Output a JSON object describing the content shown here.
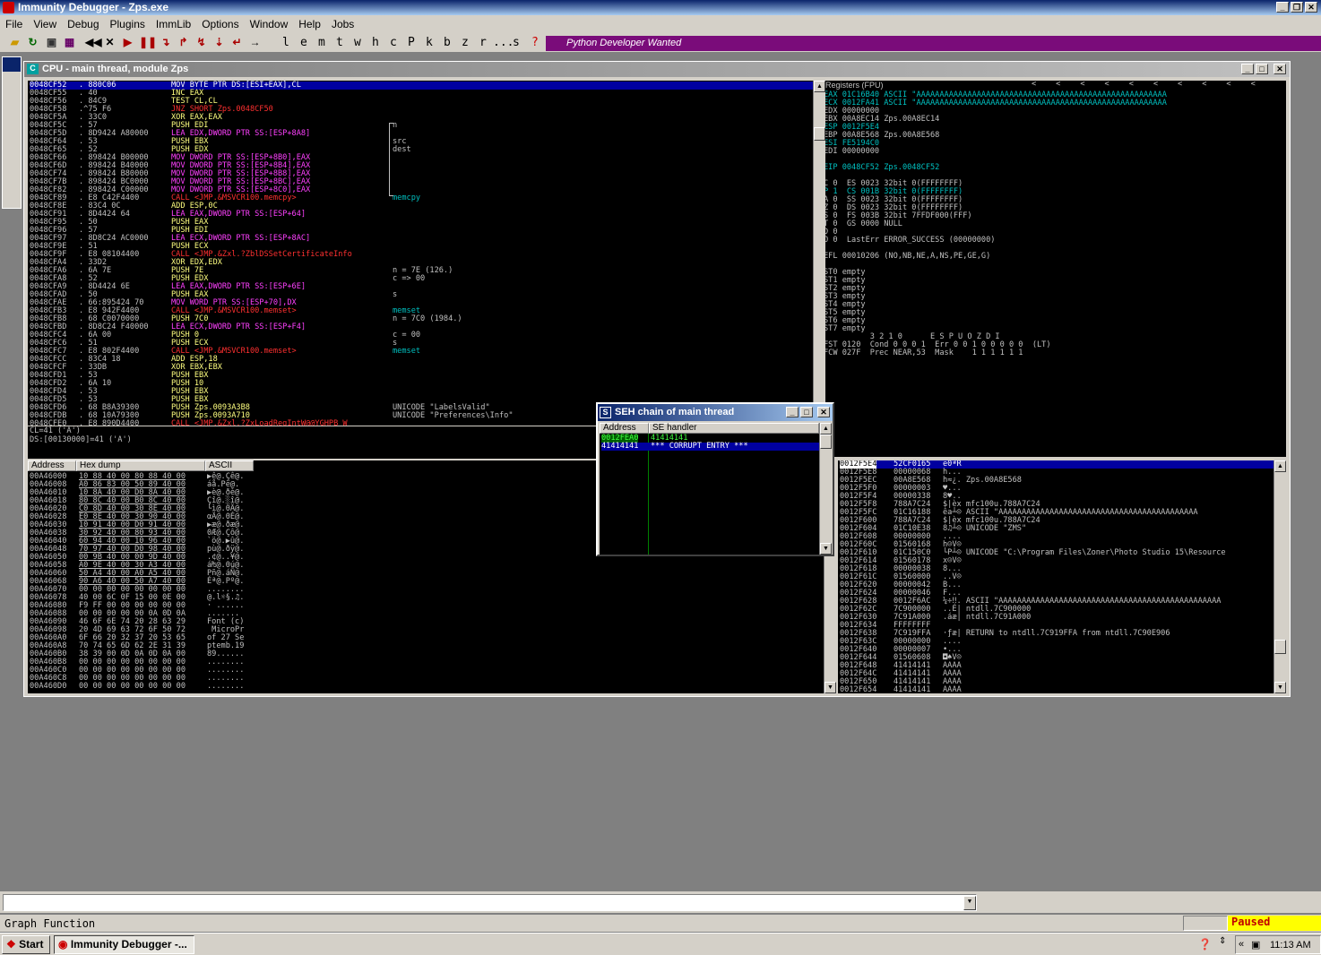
{
  "window": {
    "title": "Immunity Debugger - Zps.exe"
  },
  "menu": [
    "File",
    "View",
    "Debug",
    "Plugins",
    "ImmLib",
    "Options",
    "Window",
    "Help",
    "Jobs"
  ],
  "toolbar": {
    "letters": [
      "l",
      "e",
      "m",
      "t",
      "w",
      "h",
      "c",
      "P",
      "k",
      "b",
      "z",
      "r",
      "...",
      "s",
      "?"
    ],
    "banner": "Python Developer Wanted"
  },
  "cpu": {
    "title": "CPU - main thread, module Zps"
  },
  "disasm": [
    [
      "0048CF52",
      ". 880C06",
      "MOV BYTE PTR DS:[ESI+EAX],CL",
      ""
    ],
    [
      "0048CF55",
      ". 40",
      "INC EAX",
      ""
    ],
    [
      "0048CF56",
      ". 84C9",
      "TEST CL,CL",
      ""
    ],
    [
      "0048CF58",
      ".^75 F6",
      "JNZ SHORT Zps.0048CF50",
      ""
    ],
    [
      "0048CF5A",
      ". 33C0",
      "XOR EAX,EAX",
      ""
    ],
    [
      "0048CF5C",
      ". 57",
      "PUSH EDI",
      "n"
    ],
    [
      "0048CF5D",
      ". 8D9424 A80000",
      "LEA EDX,DWORD PTR SS:[ESP+8A8]",
      ""
    ],
    [
      "0048CF64",
      ". 53",
      "PUSH EBX",
      "src"
    ],
    [
      "0048CF65",
      ". 52",
      "PUSH EDX",
      "dest"
    ],
    [
      "0048CF66",
      ". 898424 B00000",
      "MOV DWORD PTR SS:[ESP+8B0],EAX",
      ""
    ],
    [
      "0048CF6D",
      ". 898424 B40000",
      "MOV DWORD PTR SS:[ESP+8B4],EAX",
      ""
    ],
    [
      "0048CF74",
      ". 898424 B80000",
      "MOV DWORD PTR SS:[ESP+8B8],EAX",
      ""
    ],
    [
      "0048CF7B",
      ". 898424 BC0000",
      "MOV DWORD PTR SS:[ESP+8BC],EAX",
      ""
    ],
    [
      "0048CF82",
      ". 898424 C00000",
      "MOV DWORD PTR SS:[ESP+8C0],EAX",
      ""
    ],
    [
      "0048CF89",
      ". E8 C42F4400",
      "CALL <JMP.&MSVCR100.memcpy>",
      "memcpy"
    ],
    [
      "0048CF8E",
      ". 83C4 0C",
      "ADD ESP,0C",
      ""
    ],
    [
      "0048CF91",
      ". 8D4424 64",
      "LEA EAX,DWORD PTR SS:[ESP+64]",
      ""
    ],
    [
      "0048CF95",
      ". 50",
      "PUSH EAX",
      ""
    ],
    [
      "0048CF96",
      ". 57",
      "PUSH EDI",
      ""
    ],
    [
      "0048CF97",
      ". 8D8C24 AC0000",
      "LEA ECX,DWORD PTR SS:[ESP+8AC]",
      ""
    ],
    [
      "0048CF9E",
      ". 51",
      "PUSH ECX",
      ""
    ],
    [
      "0048CF9F",
      ". E8 08104400",
      "CALL <JMP.&Zxl.?ZblDSSetCertificateInfo",
      ""
    ],
    [
      "0048CFA4",
      ". 33D2",
      "XOR EDX,EDX",
      ""
    ],
    [
      "0048CFA6",
      ". 6A 7E",
      "PUSH 7E",
      "n = 7E (126.)"
    ],
    [
      "0048CFA8",
      ". 52",
      "PUSH EDX",
      "c => 00"
    ],
    [
      "0048CFA9",
      ". 8D4424 6E",
      "LEA EAX,DWORD PTR SS:[ESP+6E]",
      ""
    ],
    [
      "0048CFAD",
      ". 50",
      "PUSH EAX",
      "s"
    ],
    [
      "0048CFAE",
      ". 66:895424 70",
      "MOV WORD PTR SS:[ESP+70],DX",
      ""
    ],
    [
      "0048CFB3",
      ". E8 942F4400",
      "CALL <JMP.&MSVCR100.memset>",
      "memset"
    ],
    [
      "0048CFB8",
      ". 68 C0070000",
      "PUSH 7C0",
      "n = 7C0 (1984.)"
    ],
    [
      "0048CFBD",
      ". 8D8C24 F40000",
      "LEA ECX,DWORD PTR SS:[ESP+F4]",
      ""
    ],
    [
      "0048CFC4",
      ". 6A 00",
      "PUSH 0",
      "c = 00"
    ],
    [
      "0048CFC6",
      ". 51",
      "PUSH ECX",
      "s"
    ],
    [
      "0048CFC7",
      ". E8 802F4400",
      "CALL <JMP.&MSVCR100.memset>",
      "memset"
    ],
    [
      "0048CFCC",
      ". 83C4 18",
      "ADD ESP,18",
      ""
    ],
    [
      "0048CFCF",
      ". 33DB",
      "XOR EBX,EBX",
      ""
    ],
    [
      "0048CFD1",
      ". 53",
      "PUSH EBX",
      ""
    ],
    [
      "0048CFD2",
      ". 6A 10",
      "PUSH 10",
      ""
    ],
    [
      "0048CFD4",
      ". 53",
      "PUSH EBX",
      ""
    ],
    [
      "0048CFD5",
      ". 53",
      "PUSH EBX",
      ""
    ],
    [
      "0048CFD6",
      ". 68 B8A39300",
      "PUSH Zps.0093A3B8",
      "UNICODE \"LabelsValid\""
    ],
    [
      "0048CFDB",
      ". 68 10A79300",
      "PUSH Zps.0093A710",
      "UNICODE \"Preferences\\Info\""
    ],
    [
      "0048CFE0",
      ". E8 890D4400",
      "CALL <JMP.&Zxl.?ZxLoadRegIntW@@YGHPB_W",
      ""
    ]
  ],
  "info": [
    "CL=41 ('A')",
    "DS:[00130000]=41 ('A')"
  ],
  "registers": {
    "title": "Registers (FPU)",
    "lines": [
      "EAX 01C16B40 ASCII \"AAAAAAAAAAAAAAAAAAAAAAAAAAAAAAAAAAAAAAAAAAAAAAAAAAAAAA",
      "ECX 0012FA41 ASCII \"AAAAAAAAAAAAAAAAAAAAAAAAAAAAAAAAAAAAAAAAAAAAAAAAAAAAAA",
      "EDX 00000000",
      "EBX 00A8EC14 Zps.00A8EC14",
      "ESP 0012F5E4",
      "EBP 00A8E568 Zps.00A8E568",
      "ESI FE5194C0",
      "EDI 00000000",
      "",
      "EIP 0048CF52 Zps.0048CF52",
      "",
      "C 0  ES 0023 32bit 0(FFFFFFFF)",
      "P 1  CS 001B 32bit 0(FFFFFFFF)",
      "A 0  SS 0023 32bit 0(FFFFFFFF)",
      "Z 0  DS 0023 32bit 0(FFFFFFFF)",
      "S 0  FS 003B 32bit 7FFDF000(FFF)",
      "T 0  GS 0000 NULL",
      "D 0",
      "O 0  LastErr ERROR_SUCCESS (00000000)",
      "",
      "EFL 00010206 (NO,NB,NE,A,NS,PE,GE,G)",
      "",
      "ST0 empty",
      "ST1 empty",
      "ST2 empty",
      "ST3 empty",
      "ST4 empty",
      "ST5 empty",
      "ST6 empty",
      "ST7 empty",
      "          3 2 1 0      E S P U O Z D I",
      "FST 0120  Cond 0 0 0 1  Err 0 0 1 0 0 0 0 0  (LT)",
      "FCW 027F  Prec NEAR,53  Mask    1 1 1 1 1 1"
    ]
  },
  "dump": {
    "headers": [
      "Address",
      "Hex dump",
      "ASCII"
    ],
    "rows": [
      [
        "00A46000",
        "10 88 40 00 80 88 40 00",
        "▶ê@.Çê@."
      ],
      [
        "00A46008",
        "A0 86 83 00 50 89 40 00",
        "áå.Pë@."
      ],
      [
        "00A46010",
        "10 8A 40 00 D0 8A 40 00",
        "▶è@.ðè@."
      ],
      [
        "00A46018",
        "80 8C 40 00 B0 8C 40 00",
        "Çî@.░î@."
      ],
      [
        "00A46020",
        "C0 8D 40 00 30 8E 40 00",
        "└ì@.0Ä@."
      ],
      [
        "00A46028",
        "E0 8E 40 00 30 90 40 00",
        "αÄ@.0É@."
      ],
      [
        "00A46030",
        "10 91 40 00 D0 91 40 00",
        "▶æ@.ðæ@."
      ],
      [
        "00A46038",
        "30 92 40 00 80 93 40 00",
        "0Æ@.Çô@."
      ],
      [
        "00A46040",
        "60 94 40 00 10 96 40 00",
        "`ö@.▶û@."
      ],
      [
        "00A46048",
        "70 97 40 00 D0 98 40 00",
        "pù@.ðÿ@."
      ],
      [
        "00A46050",
        "00 9B 40 00 00 9D 40 00",
        ".¢@..¥@."
      ],
      [
        "00A46058",
        "A0 9E 40 00 30 A3 40 00",
        "á₧@.0ú@."
      ],
      [
        "00A46060",
        "50 A4 40 00 A0 A5 40 00",
        "Pñ@.áÑ@."
      ],
      [
        "00A46068",
        "90 A6 40 00 50 A7 40 00",
        "Éª@.Pº@."
      ],
      [
        "00A46070",
        "00 00 00 00 00 00 00 00",
        "........"
      ],
      [
        "00A46078",
        "40 00 6C 0F 15 00 0E 00",
        "@.l☼§.♫."
      ],
      [
        "00A46080",
        "F9 FF 00 00 00 00 00 00",
        "· ......"
      ],
      [
        "00A46088",
        "00 00 00 00 00 0A 0D 0A",
        "......."
      ],
      [
        "00A46090",
        "46 6F 6E 74 20 28 63 29",
        "Font (c)"
      ],
      [
        "00A46098",
        "20 4D 69 63 72 6F 50 72",
        " MicroPr"
      ],
      [
        "00A460A0",
        "6F 66 20 32 37 20 53 65",
        "of 27 Se"
      ],
      [
        "00A460A8",
        "70 74 65 6D 62 2E 31 39",
        "ptemb.19"
      ],
      [
        "00A460B0",
        "38 39 00 0D 0A 0D 0A 00",
        "89......"
      ],
      [
        "00A460B8",
        "00 00 00 00 00 00 00 00",
        "........"
      ],
      [
        "00A460C0",
        "00 00 00 00 00 00 00 00",
        "........"
      ],
      [
        "00A460C8",
        "00 00 00 00 00 00 00 00",
        "........"
      ],
      [
        "00A460D0",
        "00 00 00 00 00 00 00 00",
        "........"
      ]
    ]
  },
  "stack": [
    [
      "0012F5E4",
      "52CF0165",
      "e0ªR"
    ],
    [
      "0012F5E8",
      "00000068",
      "h..."
    ],
    [
      "0012F5EC",
      "00A8E568",
      "h≈¿. Zps.00A8E568"
    ],
    [
      "0012F5F0",
      "00000003",
      "♥..."
    ],
    [
      "0012F5F4",
      "00000338",
      "8♥.."
    ],
    [
      "0012F5F8",
      "788A7C24",
      "$|èx mfc100u.788A7C24"
    ],
    [
      "0012F5FC",
      "01C16188",
      "êa┴☺ ASCII \"AAAAAAAAAAAAAAAAAAAAAAAAAAAAAAAAAAAAAAAAAAA"
    ],
    [
      "0012F600",
      "788A7C24",
      "$|èx mfc100u.788A7C24"
    ],
    [
      "0012F604",
      "01C10E38",
      "8♫┴☺ UNICODE \"ZMS\""
    ],
    [
      "0012F608",
      "00000000",
      "...."
    ],
    [
      "0012F60C",
      "01560168",
      "h☺V☺"
    ],
    [
      "0012F610",
      "01C150C0",
      "└P┴☺ UNICODE \"C:\\Program Files\\Zoner\\Photo Studio 15\\Resource"
    ],
    [
      "0012F614",
      "01560178",
      "x☺V☺"
    ],
    [
      "0012F618",
      "00000038",
      "8..."
    ],
    [
      "0012F61C",
      "01560000",
      "..V☺"
    ],
    [
      "0012F620",
      "00000042",
      "B..."
    ],
    [
      "0012F624",
      "00000046",
      "F..."
    ],
    [
      "0012F628",
      "0012F6AC",
      "¼÷‼. ASCII \"AAAAAAAAAAAAAAAAAAAAAAAAAAAAAAAAAAAAAAAAAAAAAAAA"
    ],
    [
      "0012F62C",
      "7C900000",
      "..É| ntdll.7C900000"
    ],
    [
      "0012F630",
      "7C91A000",
      ".áæ| ntdll.7C91A000"
    ],
    [
      "0012F634",
      "FFFFFFFF",
      ""
    ],
    [
      "0012F638",
      "7C919FFA",
      "·ƒæ| RETURN to ntdll.7C919FFA from ntdll.7C90E906"
    ],
    [
      "0012F63C",
      "00000000",
      "...."
    ],
    [
      "0012F640",
      "00000007",
      "•..."
    ],
    [
      "0012F644",
      "01560608",
      "◘♠V☺"
    ],
    [
      "0012F648",
      "41414141",
      "AAAA"
    ],
    [
      "0012F64C",
      "41414141",
      "AAAA"
    ],
    [
      "0012F650",
      "41414141",
      "AAAA"
    ],
    [
      "0012F654",
      "41414141",
      "AAAA"
    ]
  ],
  "seh": {
    "title": "SEH chain of main thread",
    "headers": [
      "Address",
      "SE handler"
    ],
    "rows": [
      [
        "0012FEA0",
        "41414141"
      ],
      [
        "41414141",
        "*** CORRUPT ENTRY ***"
      ]
    ]
  },
  "status": {
    "left": "Graph Function",
    "right": "Paused"
  },
  "taskbar": {
    "start": "Start",
    "task": "Immunity Debugger -...",
    "clock": "11:13 AM"
  }
}
